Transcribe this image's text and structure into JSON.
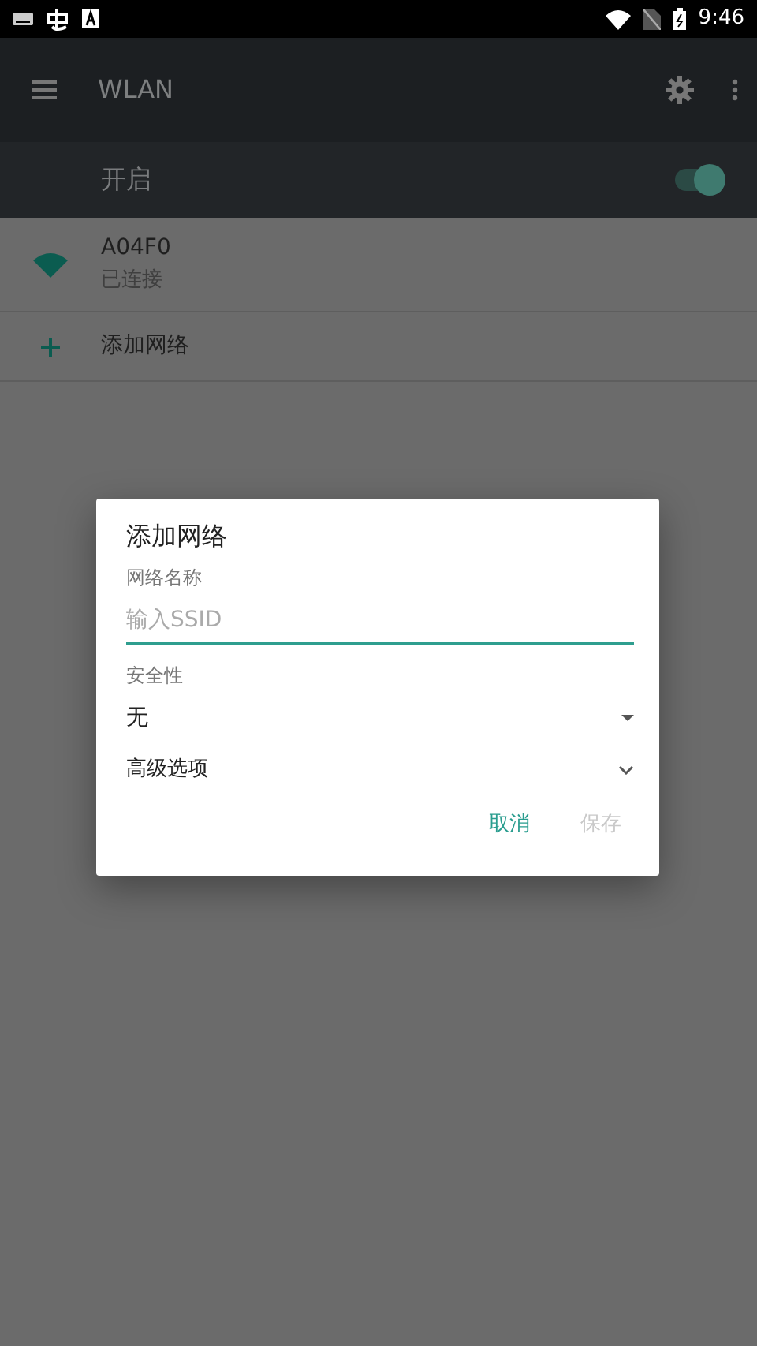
{
  "status_bar": {
    "time": "9:46"
  },
  "app_bar": {
    "title": "WLAN"
  },
  "master_switch": {
    "label": "开启",
    "on": true
  },
  "networks": [
    {
      "kind": "network",
      "name": "A04F0",
      "status": "已连接"
    },
    {
      "kind": "action",
      "name": "添加网络"
    }
  ],
  "dialog": {
    "title": "添加网络",
    "name_label": "网络名称",
    "name_field": {
      "placeholder": "输入SSID"
    },
    "security_label": "安全性",
    "security_value": "无",
    "advanced": {
      "label": "高级选项",
      "expanded": false
    },
    "buttons": [
      {
        "label": "取消",
        "disabled": false
      },
      {
        "label": "保存",
        "disabled": true
      }
    ]
  }
}
